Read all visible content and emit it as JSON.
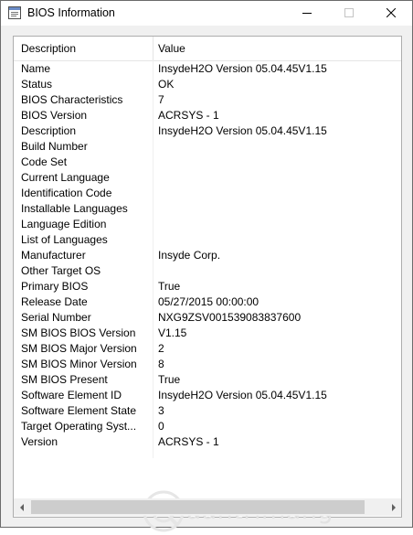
{
  "window": {
    "title": "BIOS Information"
  },
  "columns": {
    "description": "Description",
    "value": "Value"
  },
  "rows": [
    {
      "description": "Name",
      "value": "InsydeH2O Version 05.04.45V1.15"
    },
    {
      "description": "Status",
      "value": "OK"
    },
    {
      "description": "BIOS Characteristics",
      "value": "7"
    },
    {
      "description": "BIOS Version",
      "value": "ACRSYS - 1"
    },
    {
      "description": "Description",
      "value": "InsydeH2O Version 05.04.45V1.15"
    },
    {
      "description": "Build Number",
      "value": ""
    },
    {
      "description": "Code Set",
      "value": ""
    },
    {
      "description": "Current Language",
      "value": ""
    },
    {
      "description": "Identification Code",
      "value": ""
    },
    {
      "description": "Installable Languages",
      "value": ""
    },
    {
      "description": "Language Edition",
      "value": ""
    },
    {
      "description": "List of Languages",
      "value": ""
    },
    {
      "description": "Manufacturer",
      "value": "Insyde Corp."
    },
    {
      "description": "Other Target OS",
      "value": ""
    },
    {
      "description": "Primary BIOS",
      "value": "True"
    },
    {
      "description": "Release Date",
      "value": "05/27/2015 00:00:00"
    },
    {
      "description": "Serial Number",
      "value": "NXG9ZSV001539083837600"
    },
    {
      "description": "SM BIOS BIOS Version",
      "value": "V1.15"
    },
    {
      "description": "SM BIOS Major Version",
      "value": "2"
    },
    {
      "description": "SM BIOS Minor Version",
      "value": "8"
    },
    {
      "description": "SM BIOS Present",
      "value": "True"
    },
    {
      "description": "Software Element ID",
      "value": "InsydeH2O Version 05.04.45V1.15"
    },
    {
      "description": "Software Element State",
      "value": "3"
    },
    {
      "description": "Target Operating Syst...",
      "value": "0"
    },
    {
      "description": "Version",
      "value": "ACRSYS - 1"
    }
  ],
  "watermark": {
    "text": "uantrimang"
  },
  "icons": {
    "app": "window-icon",
    "minimize": "minimize-icon",
    "maximize": "maximize-icon",
    "close": "close-icon",
    "scroll_left": "arrow-left-icon",
    "scroll_right": "arrow-right-icon"
  }
}
